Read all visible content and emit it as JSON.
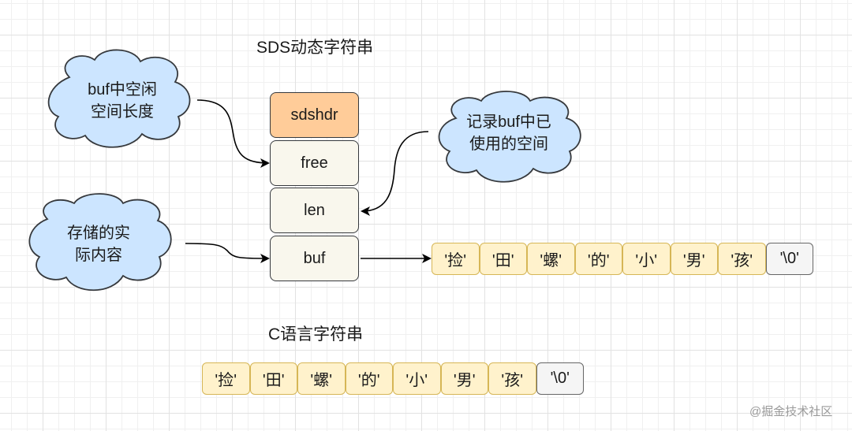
{
  "titles": {
    "sds": "SDS动态字符串",
    "c_string": "C语言字符串"
  },
  "sds_struct": {
    "fields": [
      {
        "name": "sdshdr",
        "role": "header"
      },
      {
        "name": "free",
        "role": "field"
      },
      {
        "name": "len",
        "role": "field"
      },
      {
        "name": "buf",
        "role": "field"
      }
    ]
  },
  "sds_buf_array": [
    "'捡'",
    "'田'",
    "'螺'",
    "'的'",
    "'小'",
    "'男'",
    "'孩'",
    "'\\0'"
  ],
  "c_string_array": [
    "'捡'",
    "'田'",
    "'螺'",
    "'的'",
    "'小'",
    "'男'",
    "'孩'",
    "'\\0'"
  ],
  "annotations": {
    "free": {
      "line1": "buf中空闲",
      "line2": "空间长度"
    },
    "len": {
      "line1": "记录buf中已",
      "line2": "使用的空间"
    },
    "buf": {
      "line1": "存储的实",
      "line2": "际内容"
    }
  },
  "colors": {
    "header_fill": "#ffcc99",
    "field_fill": "#f9f7ed",
    "cell_fill": "#fff2cc",
    "cell_border": "#d6b656",
    "null_fill": "#f5f5f5",
    "cloud_fill": "#cce5ff"
  },
  "watermark": "@掘金技术社区"
}
